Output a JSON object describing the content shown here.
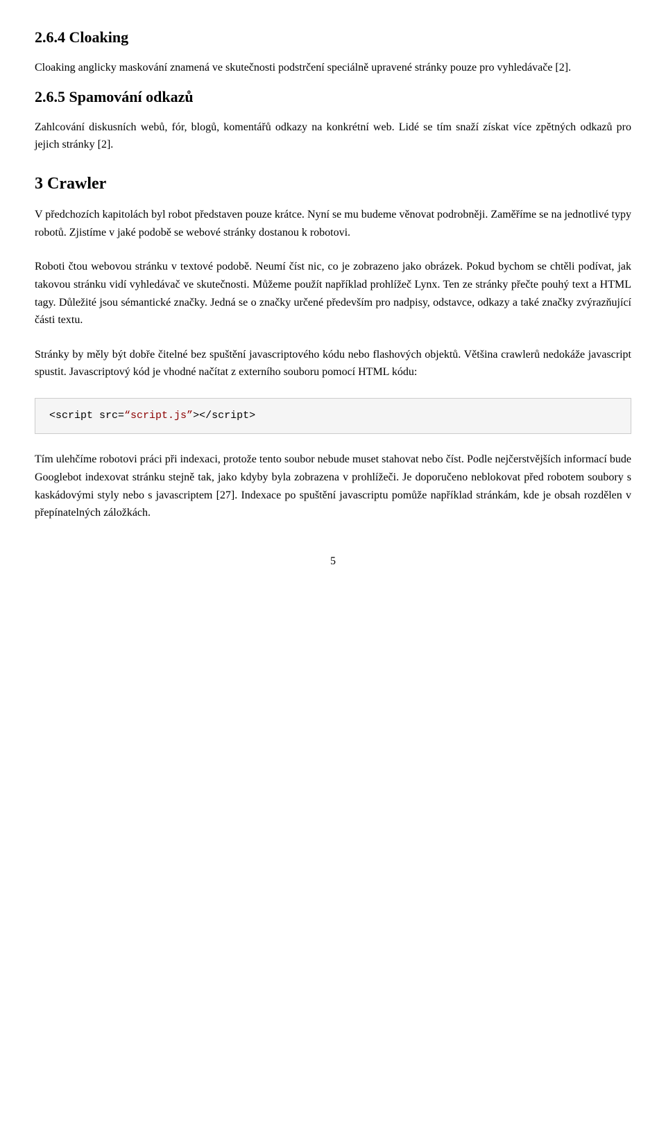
{
  "page": {
    "sections": {
      "heading_264": "2.6.4 Cloaking",
      "para_264": "Cloaking anglicky maskování znamená ve skutečnosti podstrčení speciálně upravené stránky pouze pro vyhledávače [2].",
      "heading_265": "2.6.5 Spamování odkazů",
      "para_265": "Zahlcování diskusních webů, fór, blogů, komentářů odkazy na konkrétní web. Lidé se tím snaží získat více zpětných odkazů pro jejich stránky [2].",
      "heading_3": "3 Crawler",
      "para_3_1": "V předchozích kapitolách byl robot představen pouze krátce. Nyní se mu budeme věnovat podrobněji. Zaměříme se na jednotlivé typy robotů. Zjistíme v jaké podobě se webové stránky dostanou k robotovi.",
      "para_3_2": "Roboti čtou webovou stránku v textové podobě. Neumí číst nic, co je zobrazeno jako obrázek. Pokud bychom se chtěli podívat, jak takovou stránku vidí vyhledávač ve skutečnosti. Můžeme použít například prohlížeč Lynx. Ten ze stránky přečte pouhý text a HTML tagy. Důležité jsou sémantické značky. Jedná se o značky určené především pro nadpisy, odstavce, odkazy a také značky zvýrazňující části textu.",
      "para_3_3": "Stránky by měly být dobře čitelné bez spuštění javascriptového kódu nebo flashových objektů. Většina crawlerů nedokáže javascript spustit. Javascriptový kód je vhodné načítat z externího souboru pomocí HTML kódu:",
      "code_block": "<script src=\"script.js\"></script>",
      "code_display": "<script src=„script.js‟></script>",
      "para_3_4": "Tím ulehčíme robotovi práci při indexaci, protože tento soubor nebude muset stahovat nebo číst. Podle nejčerstvějších informací bude Googlebot indexovat stránku stejně tak, jako kdyby byla zobrazena v prohlížeči. Je doporučeno neblokovat před robotem soubory s kaskádovými styly nebo s javascriptem [27]. Indexace po spuštění javascriptu pomůže například stránkám, kde je obsah rozdělen v přepínatelných záložkách.",
      "page_number": "5"
    }
  }
}
